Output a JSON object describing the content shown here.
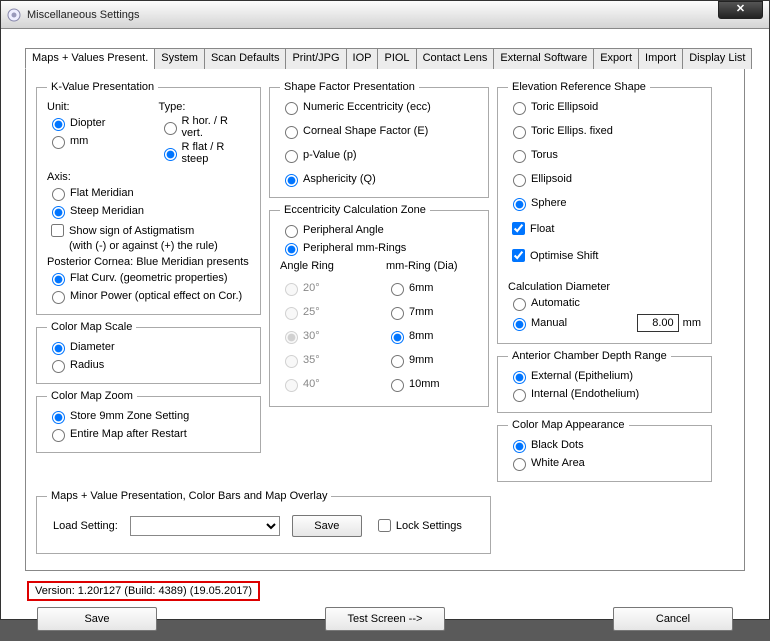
{
  "window": {
    "title": "Miscellaneous Settings",
    "close": "✕"
  },
  "tabs": {
    "items": [
      "Maps + Values Present.",
      "System",
      "Scan Defaults",
      "Print/JPG",
      "IOP",
      "PIOL",
      "Contact Lens",
      "External Software",
      "Export",
      "Import",
      "Display List"
    ],
    "active": 0
  },
  "kvalue": {
    "legend": "K-Value Presentation",
    "unit_label": "Unit:",
    "type_label": "Type:",
    "unit_opts": {
      "diopter": "Diopter",
      "mm": "mm"
    },
    "type_opts": {
      "hv": "R hor. / R vert.",
      "fs": "R flat / R steep"
    },
    "axis_label": "Axis:",
    "axis_opts": {
      "flat": "Flat Meridian",
      "steep": "Steep Meridian"
    },
    "show_sign": "Show sign of Astigmatism",
    "sign_note": "(with (-) or against (+) the rule)",
    "posterior_title": "Posterior Cornea: Blue Meridian presents",
    "post_opts": {
      "flat": "Flat Curv. (geometric properties)",
      "minor": "Minor Power (optical effect on Cor.)"
    }
  },
  "cms": {
    "legend": "Color Map Scale",
    "opts": {
      "diameter": "Diameter",
      "radius": "Radius"
    }
  },
  "cmz": {
    "legend": "Color Map Zoom",
    "opts": {
      "store": "Store 9mm Zone Setting",
      "entire": "Entire Map after Restart"
    }
  },
  "shape": {
    "legend": "Shape Factor Presentation",
    "opts": {
      "ecc": "Numeric Eccentricity (ecc)",
      "e": "Corneal Shape Factor (E)",
      "p": "p-Value (p)",
      "q": "Asphericity (Q)"
    }
  },
  "eccz": {
    "legend": "Eccentricity Calculation Zone",
    "opts": {
      "angle": "Peripheral Angle",
      "mm": "Peripheral mm-Rings"
    },
    "angle_head": "Angle Ring",
    "mm_head": "mm-Ring (Dia)",
    "angles": [
      "20°",
      "25°",
      "30°",
      "35°",
      "40°"
    ],
    "mms": [
      "6mm",
      "7mm",
      "8mm",
      "9mm",
      "10mm"
    ]
  },
  "elev": {
    "legend": "Elevation Reference Shape",
    "opts": {
      "te": "Toric Ellipsoid",
      "tef": "Toric Ellips. fixed",
      "torus": "Torus",
      "ell": "Ellipsoid",
      "sphere": "Sphere"
    },
    "float": "Float",
    "opt_shift": "Optimise Shift",
    "calc_label": "Calculation Diameter",
    "calc_opts": {
      "auto": "Automatic",
      "manual": "Manual"
    },
    "manual_val": "8.00",
    "mm_unit": "mm"
  },
  "acdr": {
    "legend": "Anterior Chamber Depth Range",
    "opts": {
      "ext": "External (Epithelium)",
      "int": "Internal (Endothelium)"
    }
  },
  "cma": {
    "legend": "Color Map Appearance",
    "opts": {
      "black": "Black Dots",
      "white": "White Area"
    }
  },
  "mapsbar": {
    "legend": "Maps + Value Presentation, Color Bars and Map Overlay",
    "load_label": "Load Setting:",
    "save": "Save",
    "lock": "Lock Settings"
  },
  "version": "Version: 1.20r127  (Build: 4389) (19.05.2017)",
  "footer": {
    "save": "Save",
    "test": "Test Screen -->",
    "cancel": "Cancel"
  }
}
